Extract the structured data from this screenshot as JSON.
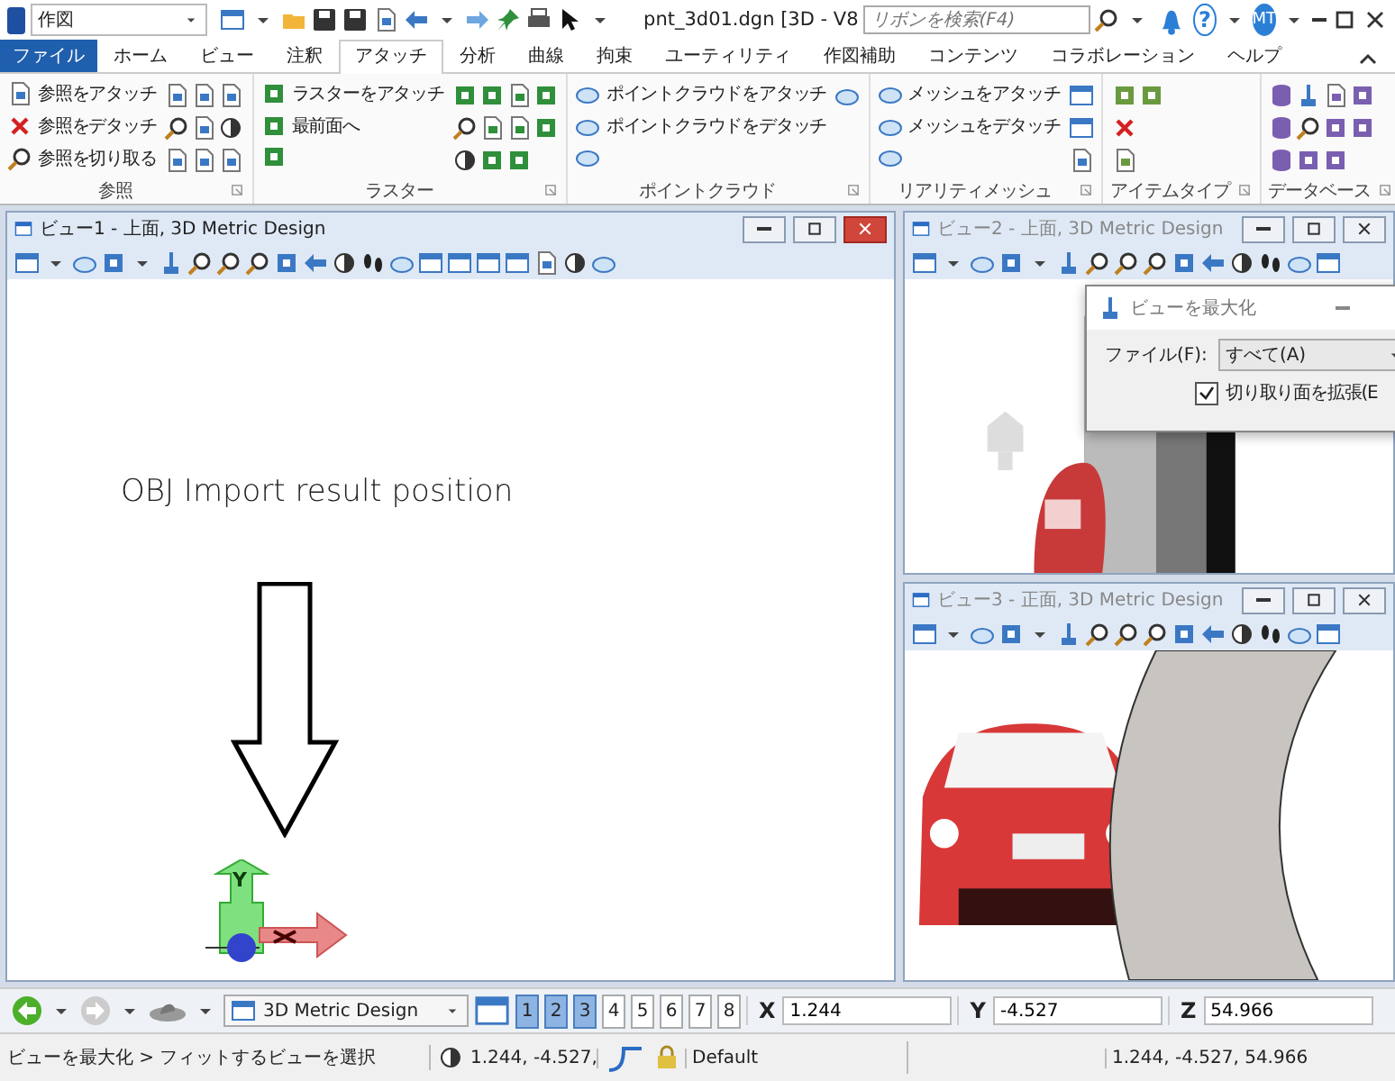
{
  "app": {
    "workspace": "作図",
    "title": "pnt_3d01.dgn [3D - V8",
    "search": {
      "placeholder": "リボンを検索(F4)"
    },
    "help_label": "?",
    "user_initials": "MT"
  },
  "tabs": [
    {
      "label": "ファイル",
      "kind": "file",
      "selected": false
    },
    {
      "label": "ホーム",
      "kind": "tab",
      "selected": false
    },
    {
      "label": "ビュー",
      "kind": "tab",
      "selected": false
    },
    {
      "label": "注釈",
      "kind": "tab",
      "selected": false
    },
    {
      "label": "アタッチ",
      "kind": "tab",
      "selected": true
    },
    {
      "label": "分析",
      "kind": "tab",
      "selected": false
    },
    {
      "label": "曲線",
      "kind": "tab",
      "selected": false
    },
    {
      "label": "拘束",
      "kind": "tab",
      "selected": false
    },
    {
      "label": "ユーティリティ",
      "kind": "tab",
      "selected": false
    },
    {
      "label": "作図補助",
      "kind": "tab",
      "selected": false
    },
    {
      "label": "コンテンツ",
      "kind": "tab",
      "selected": false
    },
    {
      "label": "コラボレーション",
      "kind": "tab",
      "selected": false
    },
    {
      "label": "ヘルプ",
      "kind": "tab",
      "selected": false
    }
  ],
  "ribbon_groups": [
    {
      "title": "参照",
      "commands": [
        "参照をアタッチ",
        "参照をデタッチ",
        "参照を切り取る"
      ]
    },
    {
      "title": "ラスター",
      "commands": [
        "ラスターをアタッチ",
        "最前面へ"
      ]
    },
    {
      "title": "ポイントクラウド",
      "commands": [
        "ポイントクラウドをアタッチ",
        "ポイントクラウドをデタッチ"
      ]
    },
    {
      "title": "リアリティメッシュ",
      "commands": [
        "メッシュをアタッチ",
        "メッシュをデタッチ"
      ]
    },
    {
      "title": "アイテムタイプ"
    },
    {
      "title": "データベース"
    }
  ],
  "views": [
    {
      "title": "ビュー1 - 上面, 3D Metric Design",
      "active": true,
      "annotation": "OBJ Import result position",
      "triad_label": "Y"
    },
    {
      "title": "ビュー2 - 上面, 3D Metric Design",
      "active": false
    },
    {
      "title": "ビュー3 - 正面, 3D Metric Design",
      "active": false
    }
  ],
  "dialog": {
    "title": "ビューを最大化",
    "field_label": "ファイル(F):",
    "value": "すべて(A)",
    "checkbox": {
      "label": "切り取り面を拡張(E",
      "checked": true
    }
  },
  "bottom_toolbar": {
    "model": "3D Metric Design",
    "view_buttons": [
      {
        "label": "1",
        "selected": true
      },
      {
        "label": "2",
        "selected": true
      },
      {
        "label": "3",
        "selected": true
      },
      {
        "label": "4",
        "selected": false
      },
      {
        "label": "5",
        "selected": false
      },
      {
        "label": "6",
        "selected": false
      },
      {
        "label": "7",
        "selected": false
      },
      {
        "label": "8",
        "selected": false
      }
    ],
    "coordinates": [
      {
        "axis": "X",
        "value": "1.244"
      },
      {
        "axis": "Y",
        "value": "-4.527"
      },
      {
        "axis": "Z",
        "value": "54.966"
      }
    ]
  },
  "status_bar": {
    "prompt": "ビューを最大化 > フィットするビューを選択",
    "short_coordinates": "1.244, -4.527,",
    "level": "Default",
    "full_coordinates": "1.244, -4.527, 54.966"
  }
}
